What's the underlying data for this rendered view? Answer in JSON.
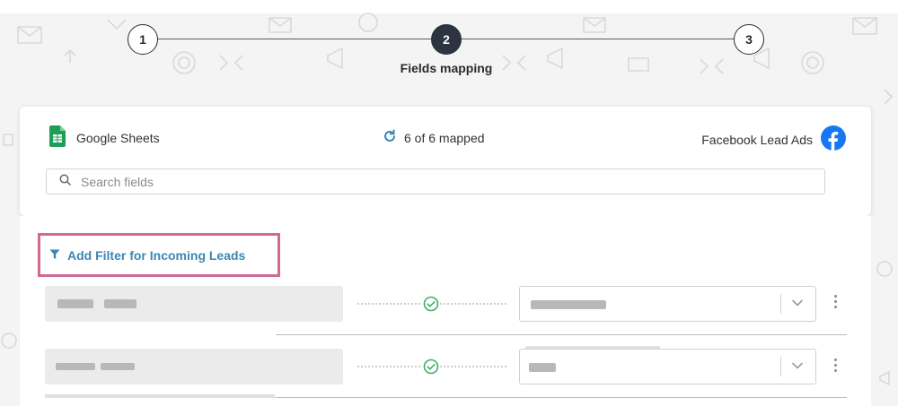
{
  "stepper": {
    "steps": [
      {
        "number": "1",
        "state": "complete"
      },
      {
        "number": "2",
        "state": "active",
        "label": "Fields mapping"
      },
      {
        "number": "3",
        "state": "upcoming"
      }
    ]
  },
  "header": {
    "source_app": "Google Sheets",
    "source_icon": "google-sheets-icon",
    "mapped_status": "6 of 6 mapped",
    "mapped_icon": "refresh-icon",
    "destination_app": "Facebook Lead Ads",
    "destination_icon": "facebook-icon"
  },
  "search": {
    "placeholder": "Search fields",
    "icon": "search-icon"
  },
  "filter": {
    "label": "Add Filter for Incoming Leads",
    "icon": "filter-icon"
  },
  "mapping_rows": [
    {
      "status": "mapped",
      "status_icon": "check-circle-icon",
      "dropdown_icon": "chevron-down-icon",
      "menu_icon": "kebab-menu-icon"
    },
    {
      "status": "mapped",
      "status_icon": "check-circle-icon",
      "dropdown_icon": "chevron-down-icon",
      "menu_icon": "kebab-menu-icon"
    }
  ],
  "colors": {
    "accent": "#3c86b4",
    "highlight_border": "#d06a95",
    "active_step": "#2b3440",
    "check": "#3fae6b",
    "facebook": "#1877f2",
    "sheets": "#1e9e56"
  }
}
